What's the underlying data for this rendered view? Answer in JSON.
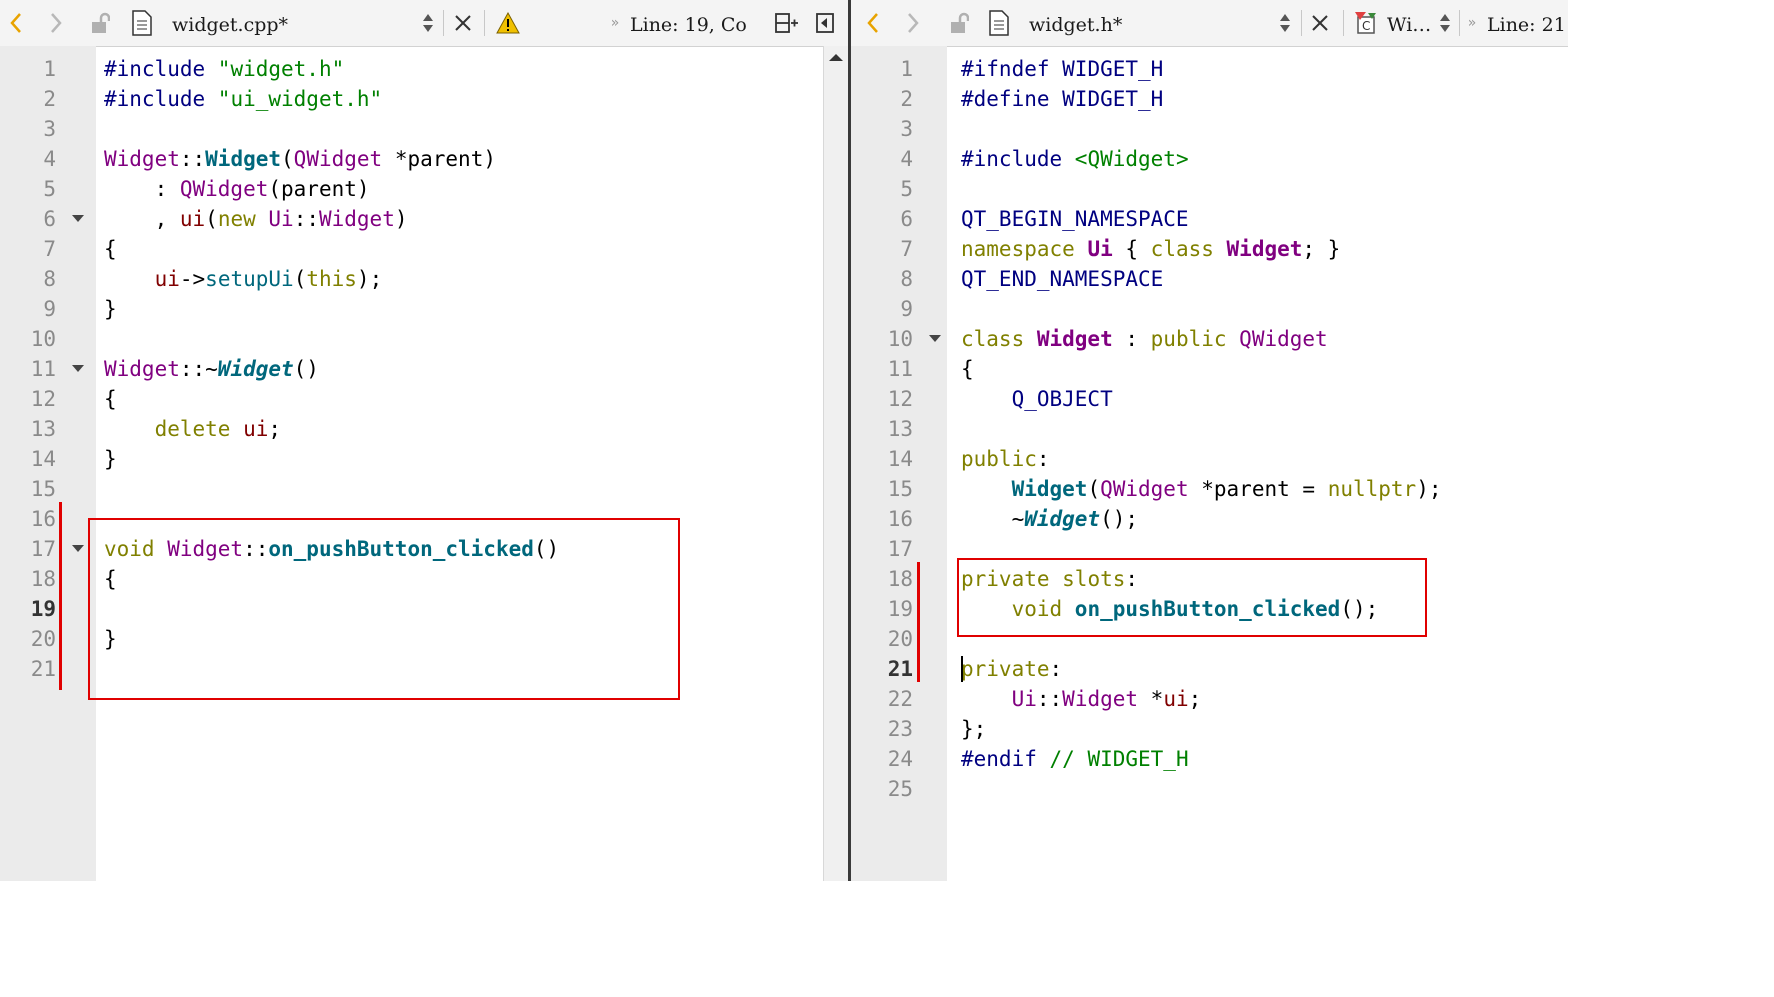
{
  "left": {
    "filename": "widget.cpp*",
    "position": "Line: 19, Co",
    "current_line": 19,
    "lines": [
      {
        "n": "1",
        "segs": [
          [
            "pp",
            "#include "
          ],
          [
            "str",
            "\"widget.h\""
          ]
        ]
      },
      {
        "n": "2",
        "segs": [
          [
            "pp",
            "#include "
          ],
          [
            "str",
            "\"ui_widget.h\""
          ]
        ]
      },
      {
        "n": "3",
        "segs": []
      },
      {
        "n": "4",
        "segs": [
          [
            "typ",
            "Widget"
          ],
          [
            "",
            "::"
          ],
          [
            "fnb",
            "Widget"
          ],
          [
            "",
            "("
          ],
          [
            "typ",
            "QWidget"
          ],
          [
            "",
            " *"
          ],
          [
            "",
            "parent)"
          ]
        ]
      },
      {
        "n": "5",
        "segs": [
          [
            "",
            "    : "
          ],
          [
            "typ",
            "QWidget"
          ],
          [
            "",
            "(parent)"
          ]
        ]
      },
      {
        "n": "6",
        "fold": true,
        "segs": [
          [
            "",
            "    , "
          ],
          [
            "mem",
            "ui"
          ],
          [
            "",
            "("
          ],
          [
            "kw",
            "new "
          ],
          [
            "typ",
            "Ui"
          ],
          [
            "",
            "::"
          ],
          [
            "typ",
            "Widget"
          ],
          [
            "",
            ")"
          ]
        ]
      },
      {
        "n": "7",
        "segs": [
          [
            "",
            "{"
          ]
        ]
      },
      {
        "n": "8",
        "segs": [
          [
            "",
            "    "
          ],
          [
            "mem",
            "ui"
          ],
          [
            "",
            "->"
          ],
          [
            "fn",
            "setupUi"
          ],
          [
            "",
            "("
          ],
          [
            "kw",
            "this"
          ],
          [
            "",
            ");"
          ]
        ]
      },
      {
        "n": "9",
        "segs": [
          [
            "",
            "}"
          ]
        ]
      },
      {
        "n": "10",
        "segs": []
      },
      {
        "n": "11",
        "fold": true,
        "segs": [
          [
            "typ",
            "Widget"
          ],
          [
            "",
            "::~"
          ],
          [
            "fni",
            "Widget"
          ],
          [
            "",
            "()"
          ]
        ]
      },
      {
        "n": "12",
        "segs": [
          [
            "",
            "{"
          ]
        ]
      },
      {
        "n": "13",
        "segs": [
          [
            "",
            "    "
          ],
          [
            "kw",
            "delete "
          ],
          [
            "mem",
            "ui"
          ],
          [
            "",
            ";"
          ]
        ]
      },
      {
        "n": "14",
        "segs": [
          [
            "",
            "}"
          ]
        ]
      },
      {
        "n": "15",
        "segs": []
      },
      {
        "n": "16",
        "segs": []
      },
      {
        "n": "17",
        "fold": true,
        "segs": [
          [
            "kw",
            "void "
          ],
          [
            "typ",
            "Widget"
          ],
          [
            "",
            "::"
          ],
          [
            "fnb",
            "on_pushButton_clicked"
          ],
          [
            "",
            "()"
          ]
        ]
      },
      {
        "n": "18",
        "segs": [
          [
            "",
            "{"
          ]
        ]
      },
      {
        "n": "19",
        "segs": []
      },
      {
        "n": "20",
        "segs": [
          [
            "",
            "}"
          ]
        ]
      },
      {
        "n": "21",
        "segs": []
      }
    ]
  },
  "right": {
    "filename": "widget.h*",
    "symbol": "Wi…",
    "position": "Line: 21",
    "current_line": 21,
    "lines": [
      {
        "n": "1",
        "segs": [
          [
            "pp",
            "#ifndef "
          ],
          [
            "mac",
            "WIDGET_H"
          ]
        ]
      },
      {
        "n": "2",
        "segs": [
          [
            "pp",
            "#define "
          ],
          [
            "mac",
            "WIDGET_H"
          ]
        ]
      },
      {
        "n": "3",
        "segs": []
      },
      {
        "n": "4",
        "segs": [
          [
            "pp",
            "#include "
          ],
          [
            "str",
            "<QWidget>"
          ]
        ]
      },
      {
        "n": "5",
        "segs": []
      },
      {
        "n": "6",
        "segs": [
          [
            "mac",
            "QT_BEGIN_NAMESPACE"
          ]
        ]
      },
      {
        "n": "7",
        "segs": [
          [
            "kw",
            "namespace "
          ],
          [
            "cls",
            "Ui"
          ],
          [
            "",
            " { "
          ],
          [
            "kw",
            "class "
          ],
          [
            "cls",
            "Widget"
          ],
          [
            "",
            "; }"
          ]
        ]
      },
      {
        "n": "8",
        "segs": [
          [
            "mac",
            "QT_END_NAMESPACE"
          ]
        ]
      },
      {
        "n": "9",
        "segs": []
      },
      {
        "n": "10",
        "fold": true,
        "segs": [
          [
            "kw",
            "class "
          ],
          [
            "cls",
            "Widget"
          ],
          [
            "",
            " : "
          ],
          [
            "kw",
            "public "
          ],
          [
            "typ",
            "QWidget"
          ]
        ]
      },
      {
        "n": "11",
        "segs": [
          [
            "",
            "{"
          ]
        ]
      },
      {
        "n": "12",
        "segs": [
          [
            "",
            "    "
          ],
          [
            "mac",
            "Q_OBJECT"
          ]
        ]
      },
      {
        "n": "13",
        "segs": []
      },
      {
        "n": "14",
        "segs": [
          [
            "kw",
            "public"
          ],
          [
            "",
            ":"
          ]
        ]
      },
      {
        "n": "15",
        "segs": [
          [
            "",
            "    "
          ],
          [
            "fnb",
            "Widget"
          ],
          [
            "",
            "("
          ],
          [
            "typ",
            "QWidget"
          ],
          [
            "",
            " *parent = "
          ],
          [
            "kw",
            "nullptr"
          ],
          [
            "",
            ");"
          ]
        ]
      },
      {
        "n": "16",
        "segs": [
          [
            "",
            "    ~"
          ],
          [
            "fni",
            "Widget"
          ],
          [
            "",
            "();"
          ]
        ]
      },
      {
        "n": "17",
        "segs": []
      },
      {
        "n": "18",
        "segs": [
          [
            "kw",
            "private "
          ],
          [
            "kw",
            "slots"
          ],
          [
            "",
            ":"
          ]
        ]
      },
      {
        "n": "19",
        "segs": [
          [
            "",
            "    "
          ],
          [
            "kw",
            "void "
          ],
          [
            "fnb",
            "on_pushButton_clicked"
          ],
          [
            "",
            "();"
          ]
        ]
      },
      {
        "n": "20",
        "segs": []
      },
      {
        "n": "21",
        "segs": [
          [
            "kw",
            "private"
          ],
          [
            "",
            ":"
          ]
        ]
      },
      {
        "n": "22",
        "segs": [
          [
            "",
            "    "
          ],
          [
            "typ",
            "Ui"
          ],
          [
            "",
            "::"
          ],
          [
            "typ",
            "Widget"
          ],
          [
            "",
            " *"
          ],
          [
            "mem",
            "ui"
          ],
          [
            "",
            ";"
          ]
        ]
      },
      {
        "n": "23",
        "segs": [
          [
            "",
            "};"
          ]
        ]
      },
      {
        "n": "24",
        "segs": [
          [
            "pp",
            "#endif "
          ],
          [
            "cmt",
            "// WIDGET_H"
          ]
        ]
      },
      {
        "n": "25",
        "segs": []
      }
    ]
  },
  "colors": {
    "highlight_box": "#e00000",
    "keyword": "#808000",
    "type": "#800080",
    "function": "#00677c",
    "preprocessor": "#000080",
    "string": "#008000"
  }
}
